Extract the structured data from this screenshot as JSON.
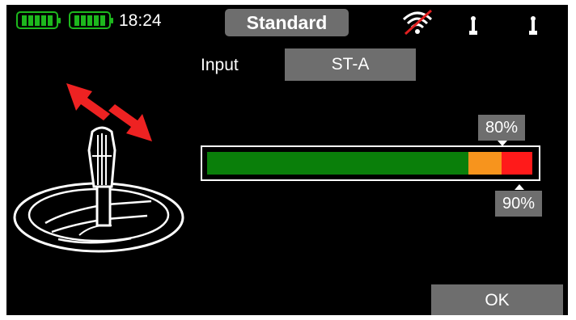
{
  "status_bar": {
    "battery_tx": "battery-icon",
    "battery_rx": "battery-icon",
    "time": "18:24",
    "mode_label": "Standard",
    "signal_icon": "no-signal-icon",
    "antenna_icon": "antenna-icon"
  },
  "input": {
    "label": "Input",
    "value": "ST-A"
  },
  "illustration_icon": "steering-stick-icon",
  "arrows_icon": "double-arrow-icon",
  "trim": {
    "upper_label": "80%",
    "lower_label": "90%",
    "upper_value": 80,
    "lower_value": 90,
    "colors": {
      "normal": "#0a7f0a",
      "warning": "#f7941d",
      "limit": "#ff1a1a"
    }
  },
  "buttons": {
    "ok_label": "OK"
  }
}
